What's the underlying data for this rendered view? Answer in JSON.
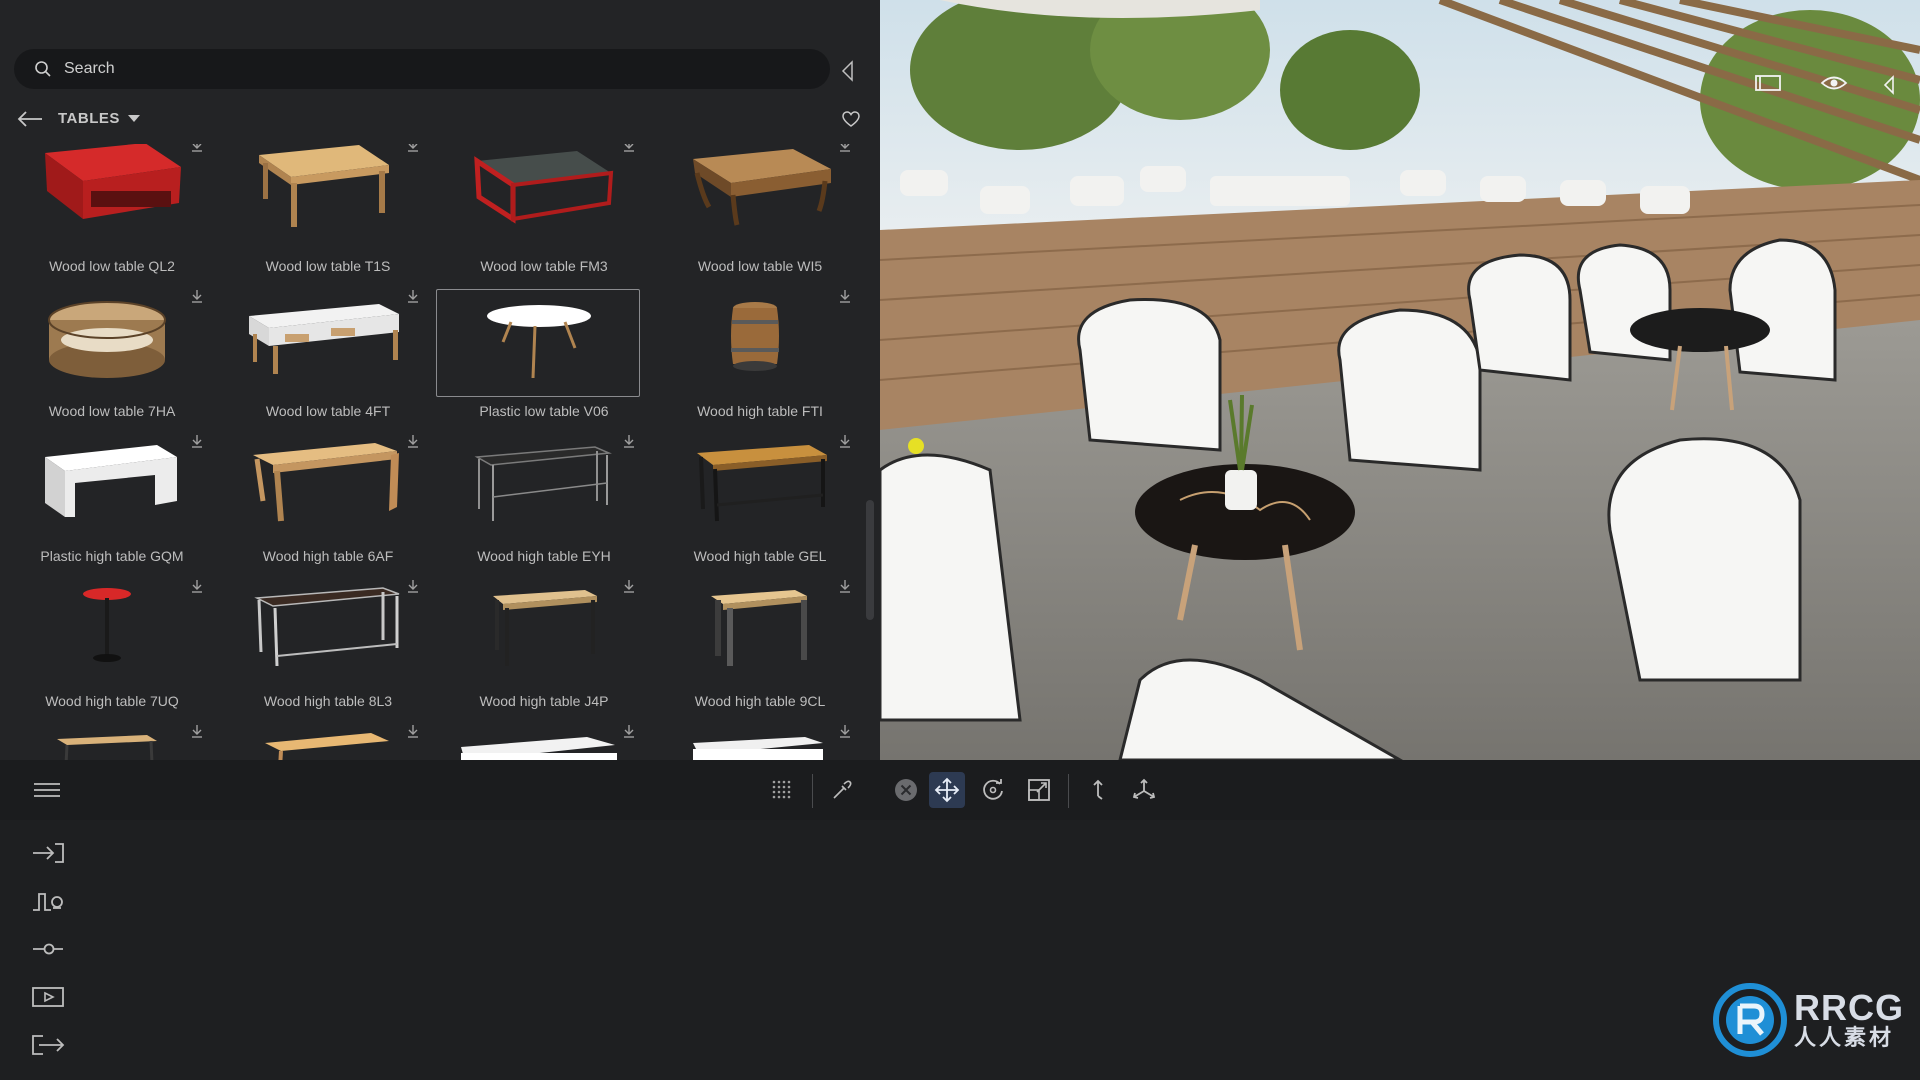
{
  "search": {
    "placeholder": "Search"
  },
  "library": {
    "category": "TABLES",
    "items": [
      {
        "label": "Wood low table QL2"
      },
      {
        "label": "Wood low table T1S"
      },
      {
        "label": "Wood low table FM3"
      },
      {
        "label": "Wood low table WI5"
      },
      {
        "label": "Wood low table 7HA"
      },
      {
        "label": "Wood low table 4FT"
      },
      {
        "label": "Plastic low table V06",
        "selected": true
      },
      {
        "label": "Wood high table FTI"
      },
      {
        "label": "Plastic high table GQM"
      },
      {
        "label": "Wood high table 6AF"
      },
      {
        "label": "Wood high table EYH"
      },
      {
        "label": "Wood high table GEL"
      },
      {
        "label": "Wood high table 7UQ"
      },
      {
        "label": "Wood high table 8L3"
      },
      {
        "label": "Wood high table J4P"
      },
      {
        "label": "Wood high table 9CL"
      },
      {
        "label": ""
      },
      {
        "label": ""
      },
      {
        "label": ""
      },
      {
        "label": ""
      }
    ]
  },
  "toolbar": {
    "tools": [
      "grid-snap",
      "eyedropper",
      "deselect",
      "move",
      "rotate",
      "scale",
      "pivot",
      "transform-axes"
    ],
    "active": "move"
  },
  "viewport_controls": [
    "aspect-frame-icon",
    "eye-icon",
    "collapse-right-icon"
  ],
  "side_rail": [
    "import-icon",
    "animation-icon",
    "slider-icon",
    "video-icon",
    "export-icon"
  ],
  "watermark": {
    "text": "RRCG",
    "subtext": "人人素材"
  },
  "colors": {
    "accent": "#2d3a52",
    "panel": "#232426",
    "toolbar": "#1b1c1e"
  }
}
